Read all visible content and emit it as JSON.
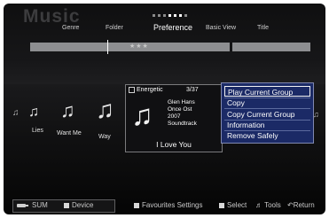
{
  "app": {
    "title": "Music"
  },
  "tabs": [
    "Genre",
    "Folder",
    "Preference",
    "Basic View",
    "Title"
  ],
  "selected_card": {
    "mood": "Energetic",
    "count": "3/37",
    "artist": "Glen Hans",
    "album": "Once Ost",
    "year": "2007",
    "genre": "Soundtrack",
    "title": "I Love You"
  },
  "tracks": [
    {
      "label": "Lies"
    },
    {
      "label": "Want Me"
    },
    {
      "label": "Way"
    }
  ],
  "context_menu": {
    "items": [
      "Play Current Group",
      "Copy",
      "Copy Current Group",
      "Information",
      "Remove Safely"
    ],
    "selected_index": 0
  },
  "bottom_left": {
    "sum": "SUM",
    "device": "Device"
  },
  "bottom_right": {
    "favourites": "Favourites Settings",
    "select": "Select",
    "tools": "Tools",
    "return": "Return"
  },
  "icons": {
    "music-note": "♫",
    "tools": "tools-icon",
    "return": "return-icon"
  },
  "colors": {
    "background": "#111112",
    "menu_bg": "#1b2a66",
    "preference_bar": "#8d8e91",
    "text": "#ffffff"
  }
}
